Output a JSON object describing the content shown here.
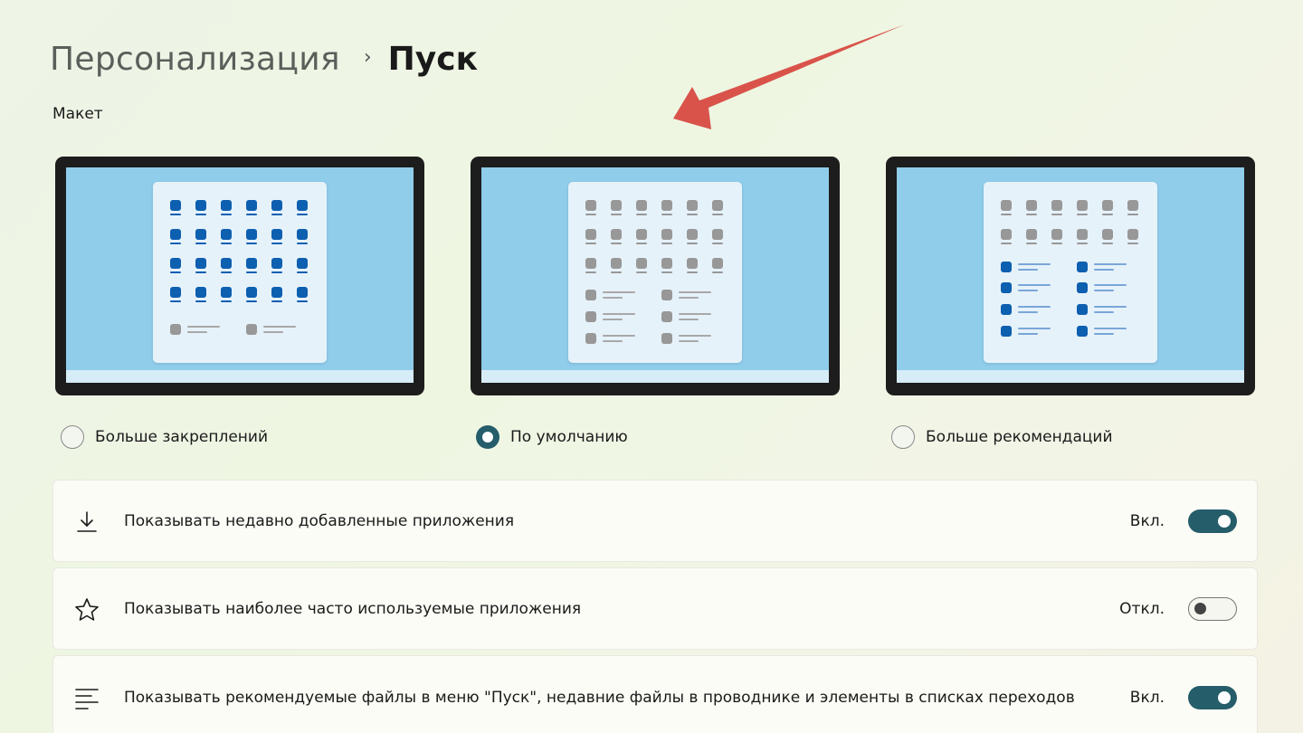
{
  "breadcrumb": {
    "parent": "Персонализация",
    "separator": "›",
    "current": "Пуск"
  },
  "layout_section": {
    "title": "Макет",
    "options": [
      {
        "label": "Больше закреплений",
        "selected": false,
        "preview": "more-pins"
      },
      {
        "label": "По умолчанию",
        "selected": true,
        "preview": "default"
      },
      {
        "label": "Больше рекомендаций",
        "selected": false,
        "preview": "more-recommendations"
      }
    ]
  },
  "settings": [
    {
      "icon": "download-icon",
      "label": "Показывать недавно добавленные приложения",
      "state_label": "Вкл.",
      "on": true
    },
    {
      "icon": "star-icon",
      "label": "Показывать наиболее часто используемые приложения",
      "state_label": "Откл.",
      "on": false
    },
    {
      "icon": "list-icon",
      "label": "Показывать рекомендуемые файлы в меню \"Пуск\", недавние файлы в проводнике и элементы в списках переходов",
      "state_label": "Вкл.",
      "on": true
    }
  ],
  "colors": {
    "accent": "#255d6a",
    "arrow": "#d9534a",
    "screen": "#8fcdeb",
    "tile_blue": "#0d5fb0",
    "tile_gray": "#989898"
  }
}
